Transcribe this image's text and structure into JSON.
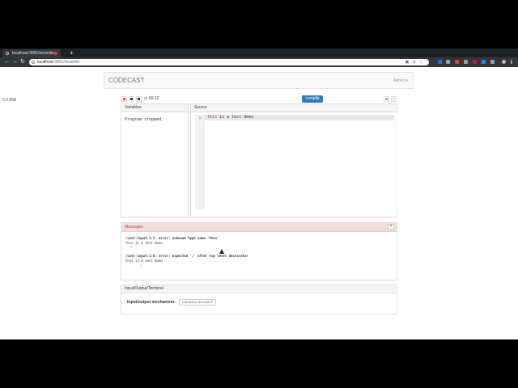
{
  "browser": {
    "tab_title": "localhost:3001/recorder",
    "new_tab": "+",
    "back": "←",
    "forward": "→",
    "reload": "↻",
    "url_host": "localhost",
    "url_path": ":3001/recorder"
  },
  "page": {
    "size_note": "0.0 MiB",
    "brand": "CODECAST",
    "admin_menu": "Admin ▾",
    "timer": "00:12",
    "compile_label": "compile"
  },
  "variables": {
    "header": "Variables",
    "status": "Program stopped."
  },
  "source": {
    "header": "Source",
    "line_number": "1",
    "code_keyword": "this",
    "code_rest": " is a test demo"
  },
  "messages": {
    "header": "Messages",
    "close": "×",
    "lines": [
      "/user-input:1:1: error: unknown type name 'this'",
      "this is a test demo",
      "^",
      "/user-input:1:8: error: expected ';' after top level declarator",
      "this is a test demo",
      ";"
    ]
  },
  "io": {
    "header": "Input/Output/Terminal",
    "label": "Input/output mechanism:",
    "selected": "Interactive terminal ⇕"
  },
  "colors": {
    "compile_button": "#337ab7",
    "messages_header_bg": "#f2dede",
    "record_dot": "#e53935"
  }
}
